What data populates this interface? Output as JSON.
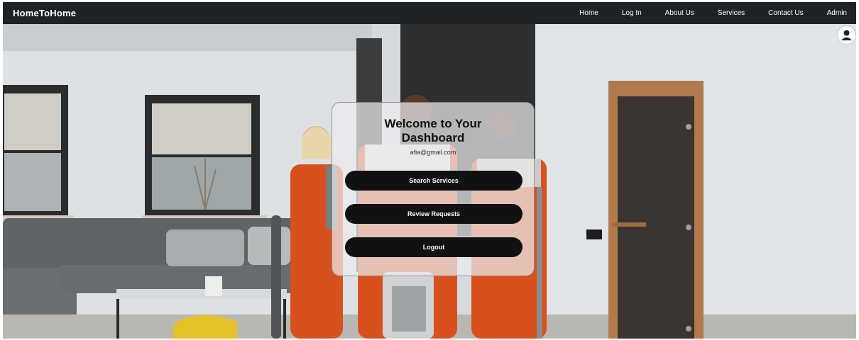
{
  "navbar": {
    "brand": "HomeToHome",
    "links": [
      "Home",
      "Log In",
      "About Us",
      "Services",
      "Contact Us",
      "Admin"
    ]
  },
  "dashboard": {
    "title_line1": "Welcome to Your",
    "title_line2": "Dashboard",
    "email": "afia@gmail.com",
    "buttons": {
      "search": "Search Services",
      "review": "Review Requests",
      "logout": "Logout"
    }
  },
  "icons": {
    "profile": "user-avatar-icon"
  },
  "colors": {
    "navbar_bg": "#1f2225",
    "button_bg": "#111111",
    "uniform_orange": "#d9501f"
  }
}
